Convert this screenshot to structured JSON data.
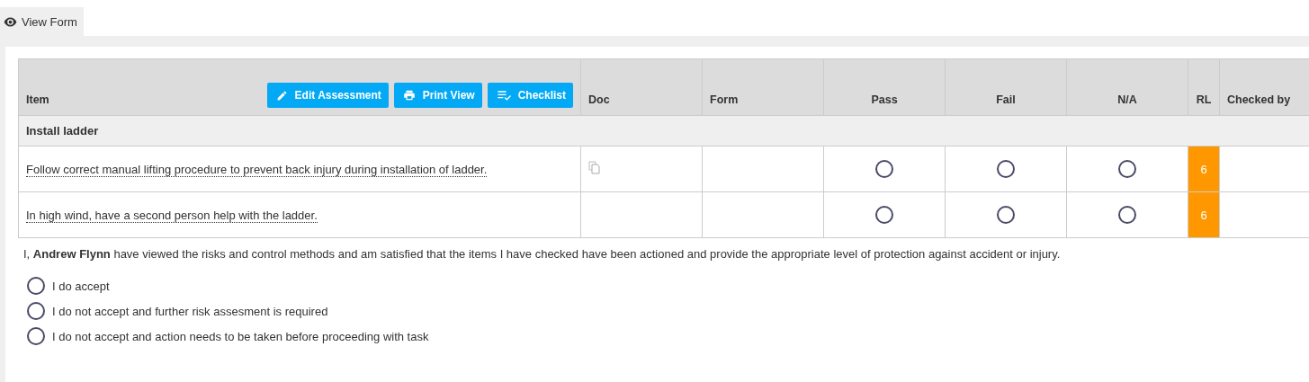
{
  "tab": {
    "label": "View Form",
    "selected": true
  },
  "table": {
    "columns": [
      {
        "label": "Item"
      },
      {
        "label": "Doc"
      },
      {
        "label": "Form"
      },
      {
        "label": "Pass"
      },
      {
        "label": "Fail"
      },
      {
        "label": "N/A"
      },
      {
        "label": "RL"
      },
      {
        "label": "Checked by"
      }
    ],
    "toolbar": [
      {
        "label": "Edit Assessment",
        "kind": "edit"
      },
      {
        "label": "Print View",
        "kind": "print"
      },
      {
        "label": "Checklist",
        "kind": "checklist"
      }
    ],
    "group": "Install ladder",
    "rows": [
      {
        "item": "Follow correct manual lifting procedure to prevent back injury during installation of ladder.",
        "has_doc": true,
        "pass": false,
        "fail": false,
        "na": false,
        "rl": "6",
        "color": "#ff9800"
      },
      {
        "item": "In high wind, have a second person help with the ladder.",
        "has_doc": false,
        "pass": false,
        "fail": false,
        "na": false,
        "rl": "6",
        "color": "#ff9800"
      }
    ]
  },
  "statement": "I, **Andrew Flynn** have viewed the risks and control methods and am satisfied that the items I have checked have been actioned and provide the appropriate level of protection against accident or injury.",
  "options": [
    {
      "label": "I do accept",
      "selected": false
    },
    {
      "label": "I do not accept and further risk assesment is required",
      "selected": false
    },
    {
      "label": "I do not accept and action needs to be taken before proceeding with task",
      "selected": false
    }
  ]
}
